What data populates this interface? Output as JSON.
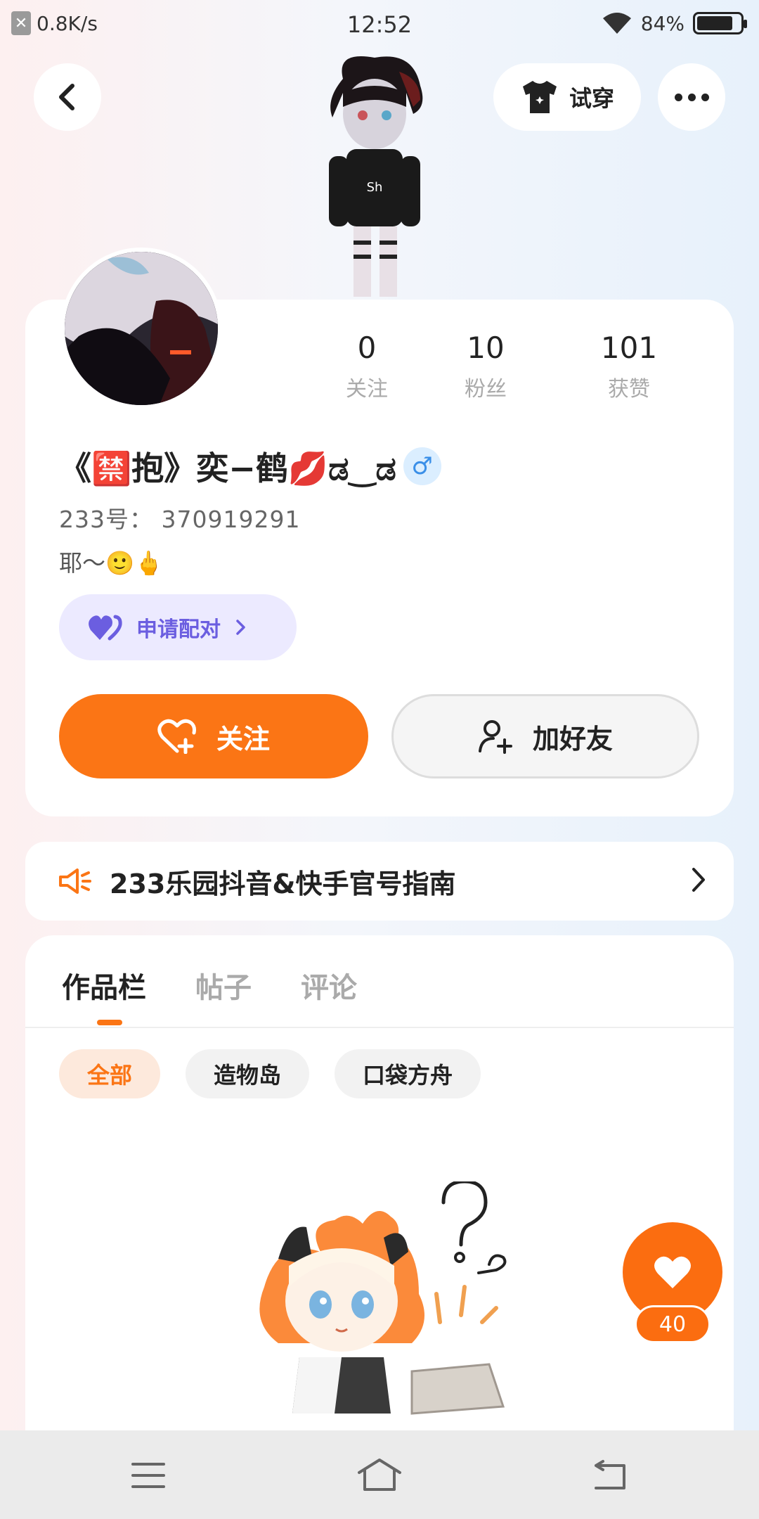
{
  "status_bar": {
    "net_speed": "0.8K/s",
    "time": "12:52",
    "battery": "84%",
    "battery_level": 0.84
  },
  "header": {
    "tryon_label": "试穿",
    "icons": [
      "back-arrow-icon",
      "tshirt-icon",
      "more-dots-icon"
    ]
  },
  "profile": {
    "stats": [
      {
        "value": "0",
        "label": "关注"
      },
      {
        "value": "10",
        "label": "粉丝"
      },
      {
        "value": "101",
        "label": "获赞"
      }
    ],
    "nickname": "《🈲抱》奕−鹤💋ಡ‿ಡ",
    "gender_symbol": "♂",
    "id_text": "233号： 370919291",
    "bio": "耶～🙂🖕",
    "pair_label": "申请配对",
    "follow_label": "关注",
    "add_friend_label": "加好友"
  },
  "notice": {
    "text": "233乐园抖音&快手官号指南"
  },
  "works": {
    "tabs": [
      "作品栏",
      "帖子",
      "评论"
    ],
    "active_tab": 0,
    "chips": [
      "全部",
      "造物岛",
      "口袋方舟"
    ],
    "active_chip": 0
  },
  "float_like": {
    "count": "40"
  },
  "colors": {
    "accent": "#fb7515",
    "pair": "#6b5ee0",
    "gender": "#3a8fe8"
  }
}
